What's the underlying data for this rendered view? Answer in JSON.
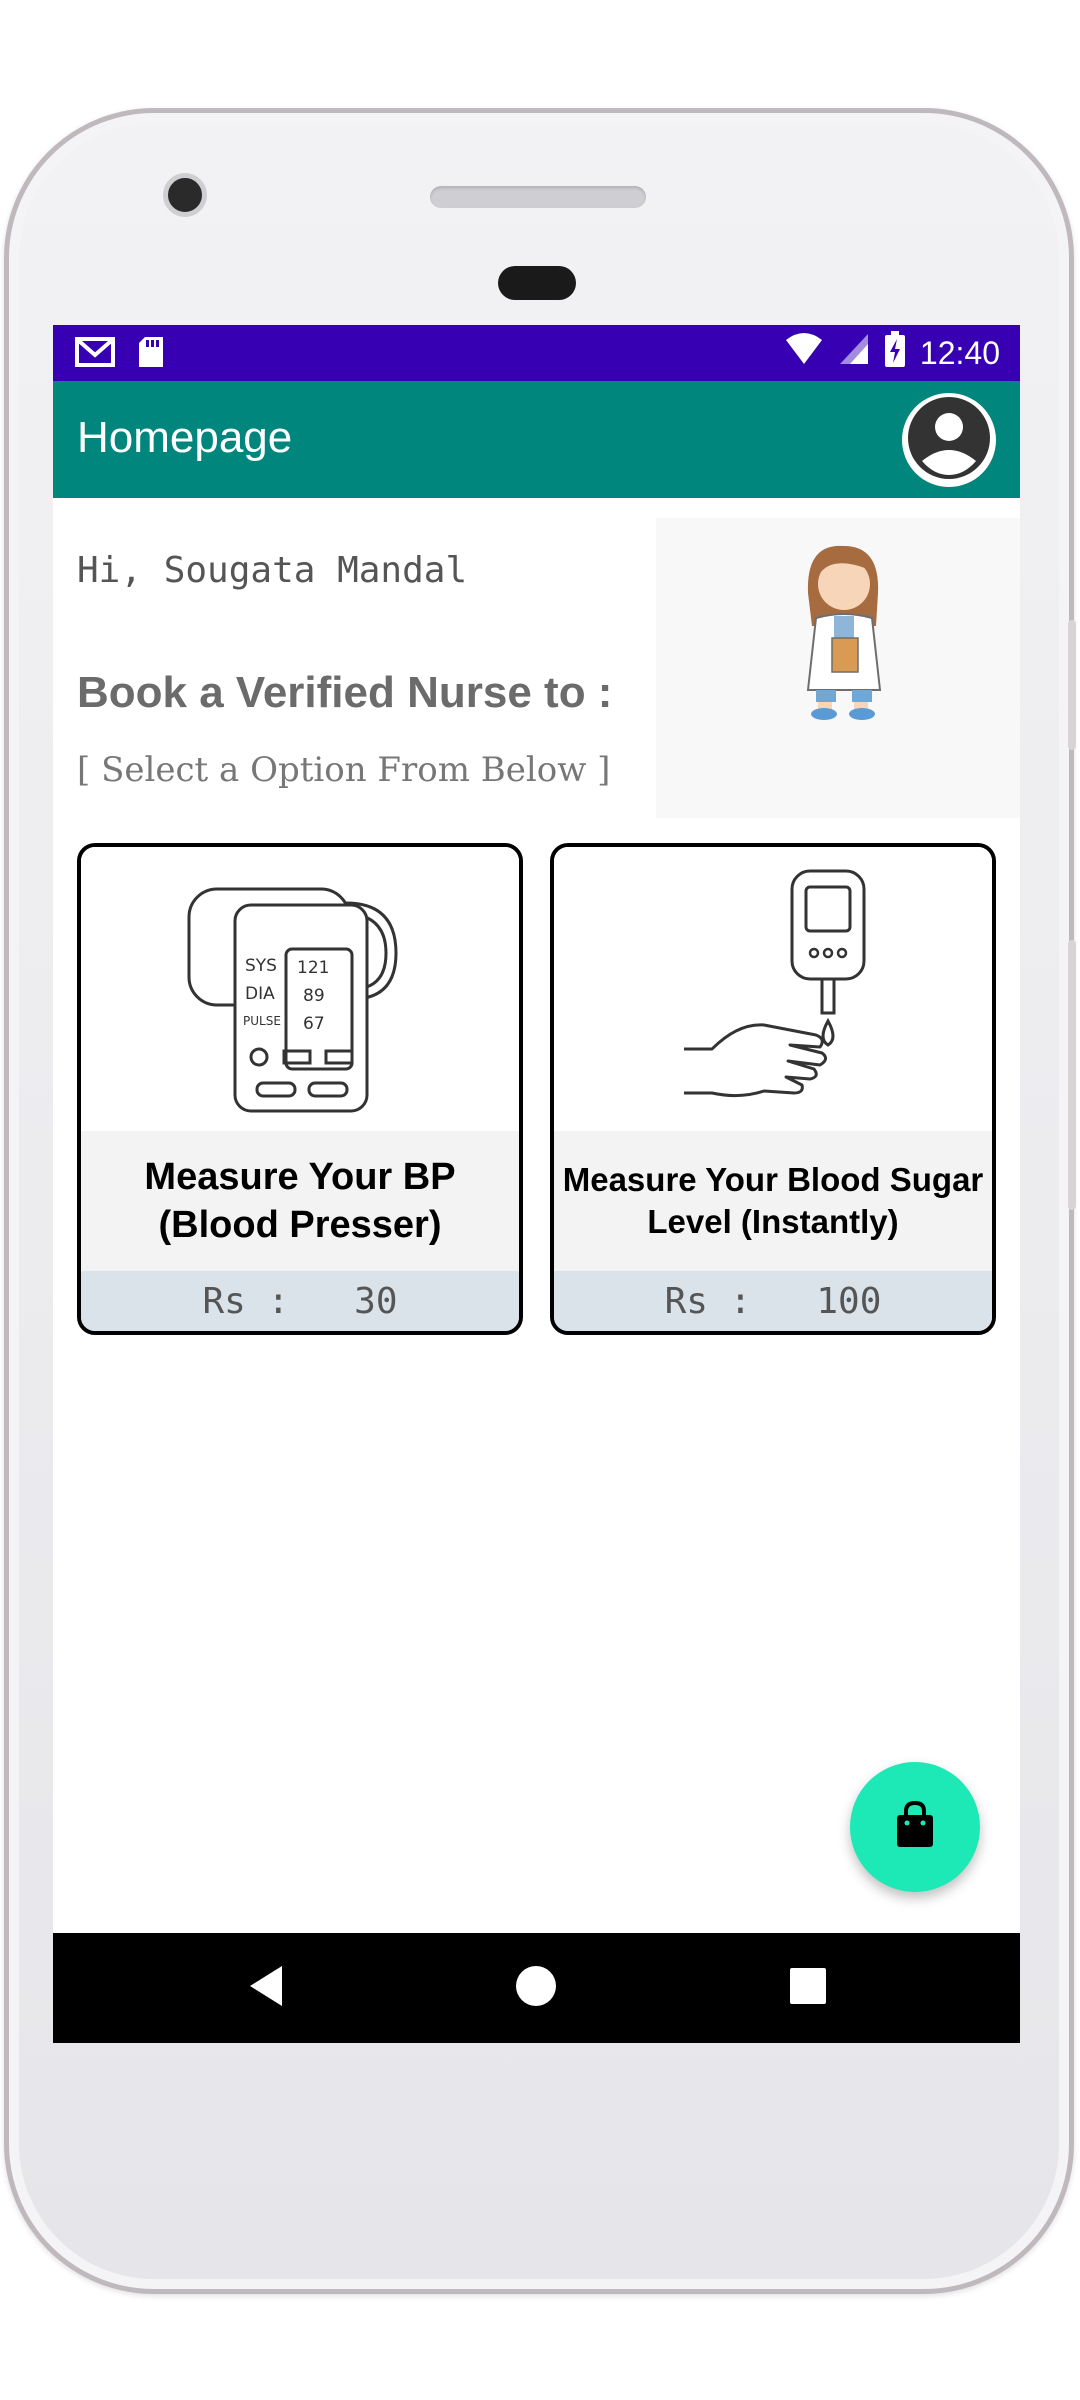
{
  "statusbar": {
    "time": "12:40",
    "icons": [
      "gmail-icon",
      "sd-card-icon",
      "wifi-icon",
      "cell-signal-icon",
      "battery-charging-icon"
    ]
  },
  "appbar": {
    "title": "Homepage",
    "profile_icon": "account-circle-icon"
  },
  "main": {
    "greeting": "Hi, Sougata Mandal",
    "headline": "Book a Verified Nurse to :",
    "subline": "[ Select a Option From Below ]",
    "illustration": "nurse-illustration"
  },
  "cards": [
    {
      "image": "bp-monitor-image",
      "title_line1": "Measure Your BP",
      "title_line2": "(Blood Presser)",
      "price": "Rs :   30",
      "monitor_labels": [
        "SYS",
        "DIA",
        "PULSE"
      ],
      "monitor_values": [
        "121",
        "89",
        "67"
      ]
    },
    {
      "image": "glucometer-image",
      "title_line1": "Measure Your Blood Sugar",
      "title_line2": "Level (Instantly)",
      "price": "Rs :   100"
    }
  ],
  "fab": {
    "icon": "shopping-bag-icon"
  },
  "navbar": {
    "icons": [
      "back-icon",
      "home-icon",
      "recents-icon"
    ]
  },
  "colors": {
    "statusbar": "#3700b3",
    "appbar": "#00867d",
    "fab": "#1de9b6",
    "price_bg": "#dae3ea"
  }
}
